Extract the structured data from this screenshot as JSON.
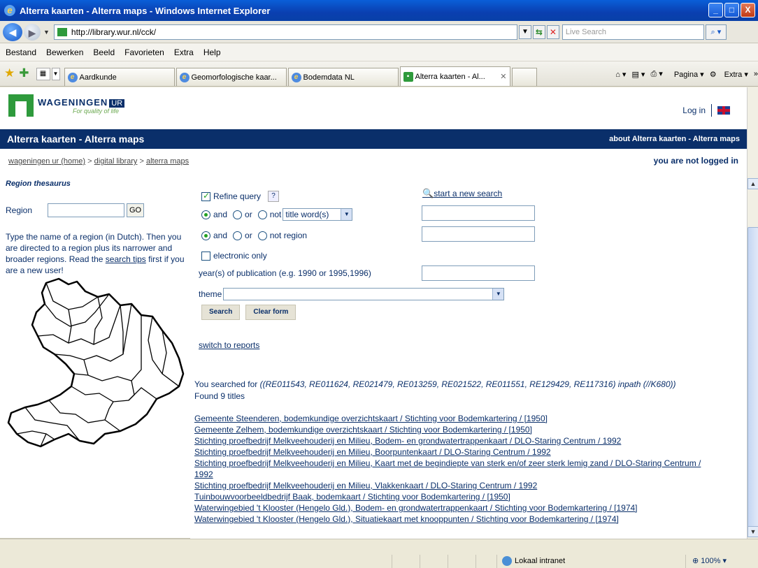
{
  "window": {
    "title": "Alterra kaarten - Alterra maps - Windows Internet Explorer",
    "minimize": "_",
    "maximize": "□",
    "close": "X"
  },
  "address": {
    "url": "http://library.wur.nl/cck/",
    "search_placeholder": "Live Search"
  },
  "menu": [
    "Bestand",
    "Bewerken",
    "Beeld",
    "Favorieten",
    "Extra",
    "Help"
  ],
  "tabs": [
    {
      "label": "Aardkunde",
      "active": false
    },
    {
      "label": "Geomorfologische kaar...",
      "active": false
    },
    {
      "label": "Bodemdata NL",
      "active": false
    },
    {
      "label": "Alterra kaarten - Al...",
      "active": true
    }
  ],
  "toolbar": {
    "page": "Pagina",
    "extra": "Extra"
  },
  "page": {
    "logo_name": "WAGENINGEN",
    "logo_ur": "UR",
    "logo_tagline": "For quality of life",
    "login": "Log in",
    "banner_title": "Alterra kaarten - Alterra maps",
    "banner_about": "about Alterra kaarten - Alterra maps",
    "breadcrumb": {
      "home": "wageningen ur (home)",
      "sep": ">",
      "library": "digital library",
      "maps": "alterra maps"
    },
    "login_state": "you are not logged in",
    "sidebar": {
      "title": "Region thesaurus",
      "region_label": "Region",
      "go": "GO",
      "help_before": "Type the name of a region (in Dutch). Then you are directed to a region plus its narrower and broader regions. Read the",
      "help_link": "search tips",
      "help_after": "first if you are a new user!"
    },
    "form": {
      "refine": "Refine query",
      "help_q": "?",
      "new_search": "start a new search",
      "and": "and",
      "or": "or",
      "not": "not",
      "title_word": "title word(s)",
      "not_region": "not region",
      "electronic_only": "electronic only",
      "years_label": "year(s) of publication (e.g. 1990 or 1995,1996)",
      "theme_label": "theme",
      "search_btn": "Search",
      "clear_btn": "Clear form"
    },
    "switch_reports": "switch to reports",
    "searched_prefix": "You searched for",
    "searched_query": "((RE011543, RE011624, RE021479, RE013259, RE021522, RE011551, RE129429, RE117316) inpath (//K680))",
    "found": "Found 9 titles",
    "results": [
      "Gemeente Steenderen, bodemkundige overzichtskaart / Stichting voor Bodemkartering / [1950]",
      "Gemeente Zelhem, bodemkundige overzichtskaart / Stichting voor Bodemkartering / [1950]",
      "Stichting proefbedrijf Melkveehouderij en Milieu, Bodem- en grondwatertrappenkaart / DLO-Staring Centrum / 1992",
      "Stichting proefbedrijf Melkveehouderij en Milieu, Boorpuntenkaart / DLO-Staring Centrum / 1992",
      "Stichting proefbedrijf Melkveehouderij en Milieu, Kaart met de begindiepte van sterk en/of zeer sterk lemig zand / DLO-Staring Centrum / 1992",
      "Stichting proefbedrijf Melkveehouderij en Milieu, Vlakkenkaart / DLO-Staring Centrum / 1992",
      "Tuinbouwvoorbeeldbedrijf Baak, bodemkaart / Stichting voor Bodemkartering / [1950]",
      "Waterwingebied 't Klooster (Hengelo Gld.), Bodem- en grondwatertrappenkaart / Stichting voor Bodemkartering / [1974]",
      "Waterwingebied 't Klooster (Hengelo Gld.), Situatiekaart met knooppunten / Stichting voor Bodemkartering / [1974]"
    ]
  },
  "status": {
    "zone": "Lokaal intranet",
    "zoom": "100%"
  }
}
